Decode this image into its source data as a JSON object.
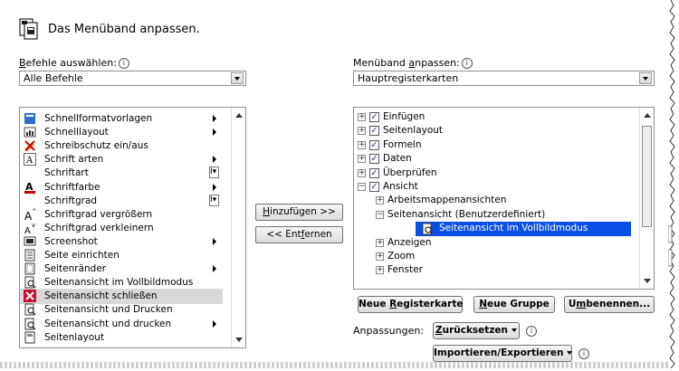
{
  "header": {
    "title": "Das Menüband anpassen."
  },
  "left": {
    "label_prefix": "B",
    "label_rest": "efehle auswählen:",
    "combo_value": "Alle Befehle",
    "items": [
      {
        "label": "Schnellformatvorlagen",
        "icon": "quick-styles-icon",
        "arrow": true
      },
      {
        "label": "Schnelllayout",
        "icon": "quick-layout-icon",
        "arrow": true
      },
      {
        "label": "Schreibschutz ein/aus",
        "icon": "protect-icon",
        "arrow": false
      },
      {
        "label": "Schrift arten",
        "icon": "font-icon",
        "arrow": true
      },
      {
        "label": "Schriftart",
        "icon": "",
        "mini": "I▾"
      },
      {
        "label": "Schriftfarbe",
        "icon": "font-color-icon",
        "arrow": true
      },
      {
        "label": "Schriftgrad",
        "icon": "",
        "mini": "I▾"
      },
      {
        "label": "Schriftgrad vergrößern",
        "icon": "grow-font-icon",
        "arrow": false
      },
      {
        "label": "Schriftgrad verkleinern",
        "icon": "shrink-font-icon",
        "arrow": false
      },
      {
        "label": "Screenshot",
        "icon": "screenshot-icon",
        "arrow": true
      },
      {
        "label": "Seite einrichten",
        "icon": "page-setup-icon",
        "arrow": false
      },
      {
        "label": "Seitenränder",
        "icon": "margins-icon",
        "arrow": true
      },
      {
        "label": "Seitenansicht im Vollbildmodus",
        "icon": "print-preview-icon",
        "arrow": false
      },
      {
        "label": "Seitenansicht schließen",
        "icon": "close-preview-icon",
        "arrow": false,
        "selected": true
      },
      {
        "label": "Seitenansicht und Drucken",
        "icon": "print-preview-icon",
        "arrow": false
      },
      {
        "label": "Seitenansicht und drucken",
        "icon": "print-preview-icon",
        "arrow": true
      },
      {
        "label": "Seitenlayout",
        "icon": "page-layout-icon",
        "arrow": false
      }
    ]
  },
  "middle": {
    "add_prefix": "H",
    "add_rest": "inzufügen >>",
    "remove_a": "<< Ent",
    "remove_u": "f",
    "remove_b": "ernen"
  },
  "right": {
    "label_a": "Menüband ",
    "label_u": "a",
    "label_b": "npassen:",
    "combo_value": "Hauptregisterkarten",
    "tree": [
      {
        "label": "Einfügen",
        "level": 0,
        "expander": "+",
        "checked": true
      },
      {
        "label": "Seitenlayout",
        "level": 0,
        "expander": "+",
        "checked": true
      },
      {
        "label": "Formeln",
        "level": 0,
        "expander": "+",
        "checked": true
      },
      {
        "label": "Daten",
        "level": 0,
        "expander": "+",
        "checked": true
      },
      {
        "label": "Überprüfen",
        "level": 0,
        "expander": "+",
        "checked": true
      },
      {
        "label": "Ansicht",
        "level": 0,
        "expander": "−",
        "checked": true
      },
      {
        "label": "Arbeitsmappenansichten",
        "level": 1,
        "expander": "+"
      },
      {
        "label": "Seitenansicht (Benutzerdefiniert)",
        "level": 1,
        "expander": "−"
      },
      {
        "label": "Seitenansicht im Vollbildmodus",
        "level": 2,
        "selected": true
      },
      {
        "label": "Anzeigen",
        "level": 1,
        "expander": "+"
      },
      {
        "label": "Zoom",
        "level": 1,
        "expander": "+"
      },
      {
        "label": "Fenster",
        "level": 1,
        "expander": "+"
      }
    ],
    "buttons": {
      "new_tab_a": "Neue ",
      "new_tab_u": "R",
      "new_tab_b": "egisterkarte",
      "new_group_a": "",
      "new_group_u": "N",
      "new_group_b": "eue Gruppe",
      "rename_a": "U",
      "rename_u": "m",
      "rename_b": "benennen..."
    },
    "custom_label": "Anpassungen:",
    "reset_a": "",
    "reset_u": "Z",
    "reset_b": "urücksetzen",
    "import_export": "Importieren/Exportieren"
  }
}
